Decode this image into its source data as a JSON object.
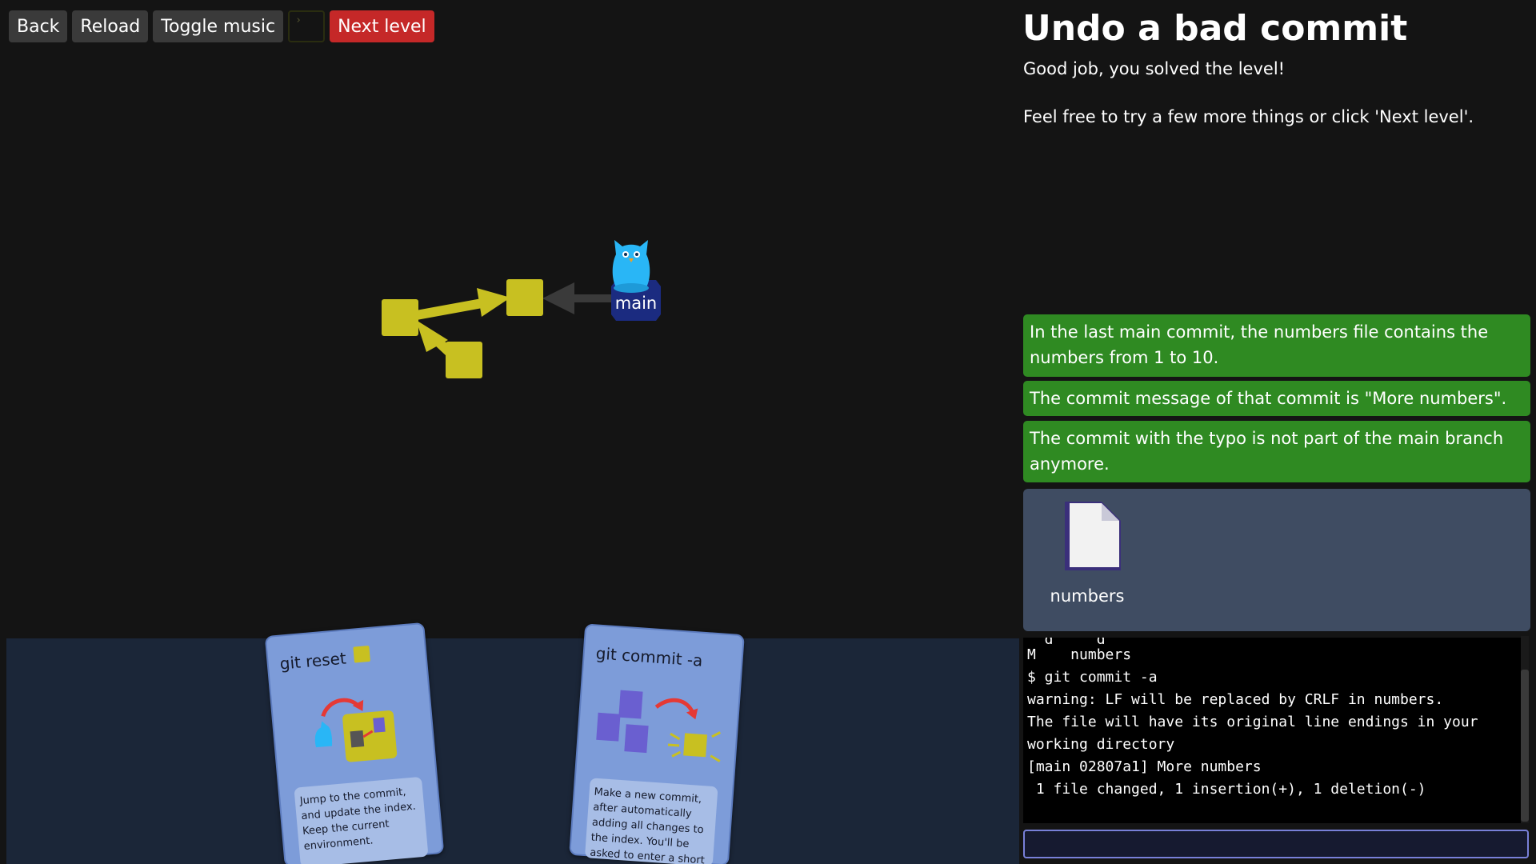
{
  "toolbar": {
    "back_label": "Back",
    "reload_label": "Reload",
    "music_label": "Toggle music",
    "terminal_glyph": "›",
    "next_label": "Next level"
  },
  "graph": {
    "branch_label": "main",
    "commit_color": "#c8c021",
    "head_color": "#1b2b80",
    "mascot_color": "#29b6f6"
  },
  "cards": [
    {
      "title": "git reset",
      "description": "Jump to the commit, and update the index. Keep the current environment."
    },
    {
      "title": "git commit -a",
      "description": "Make a new commit, after automatically adding all changes to the index. You'll be asked to enter a short description of the change."
    }
  ],
  "level": {
    "title": "Undo a bad commit",
    "message_line1": "Good job, you solved the level!",
    "message_line2": "Feel free to try a few more things or click 'Next level'."
  },
  "goals": [
    "In the last main commit, the numbers file contains the numbers from 1 to 10.",
    "The commit message of that commit is \"More numbers\".",
    "The commit with the typo is not part of the main branch anymore."
  ],
  "files": [
    {
      "name": "numbers",
      "icon": "file-icon"
    }
  ],
  "terminal": {
    "lines": [
      "M    numbers",
      "$ git commit -a",
      "warning: LF will be replaced by CRLF in numbers.",
      "The file will have its original line endings in your",
      "working directory",
      "[main 02807a1] More numbers",
      " 1 file changed, 1 insertion(+), 1 deletion(-)"
    ],
    "input_value": ""
  },
  "colors": {
    "goal_done": "#2f8a22",
    "next_button": "#c52828",
    "card": "#7d9cd9"
  }
}
